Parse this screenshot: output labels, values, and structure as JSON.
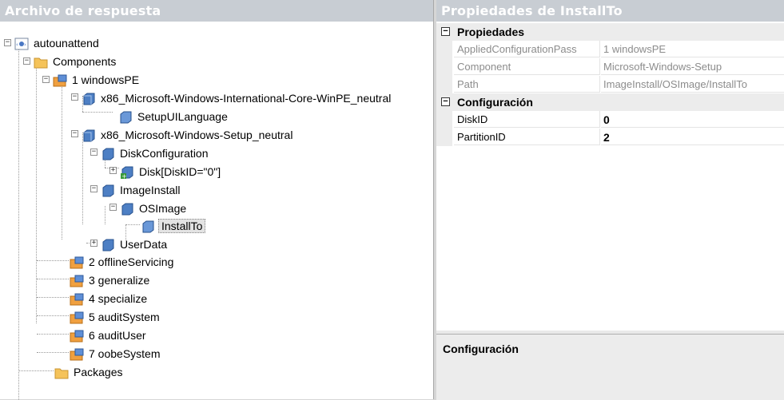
{
  "left_pane": {
    "title": "Archivo de respuesta"
  },
  "right_pane": {
    "title": "Propiedades de InstallTo"
  },
  "tree": {
    "root": "autounattend",
    "components": "Components",
    "windowsPE": "1 windowsPE",
    "intl_core": "x86_Microsoft-Windows-International-Core-WinPE_neutral",
    "setup_ui_language": "SetupUILanguage",
    "setup": "x86_Microsoft-Windows-Setup_neutral",
    "disk_configuration": "DiskConfiguration",
    "disk": "Disk[DiskID=\"0\"]",
    "image_install": "ImageInstall",
    "os_image": "OSImage",
    "install_to": "InstallTo",
    "user_data": "UserData",
    "offline_servicing": "2 offlineServicing",
    "generalize": "3 generalize",
    "specialize": "4 specialize",
    "audit_system": "5 auditSystem",
    "audit_user": "6 auditUser",
    "oobe_system": "7 oobeSystem",
    "packages": "Packages"
  },
  "properties": {
    "cat_props": "Propiedades",
    "cat_config": "Configuración",
    "applied_pass_name": "AppliedConfigurationPass",
    "applied_pass_value": "1 windowsPE",
    "component_name": "Component",
    "component_value": "Microsoft-Windows-Setup",
    "path_name": "Path",
    "path_value": "ImageInstall/OSImage/InstallTo",
    "diskid_name": "DiskID",
    "diskid_value": "0",
    "partitionid_name": "PartitionID",
    "partitionid_value": "2"
  },
  "description": {
    "title": "Configuración"
  },
  "colors": {
    "header_bg": "#c8cdd3",
    "pass_orange": "#f0a040",
    "folder": "#f5c35a",
    "component_blue": "#4d7fc4"
  }
}
